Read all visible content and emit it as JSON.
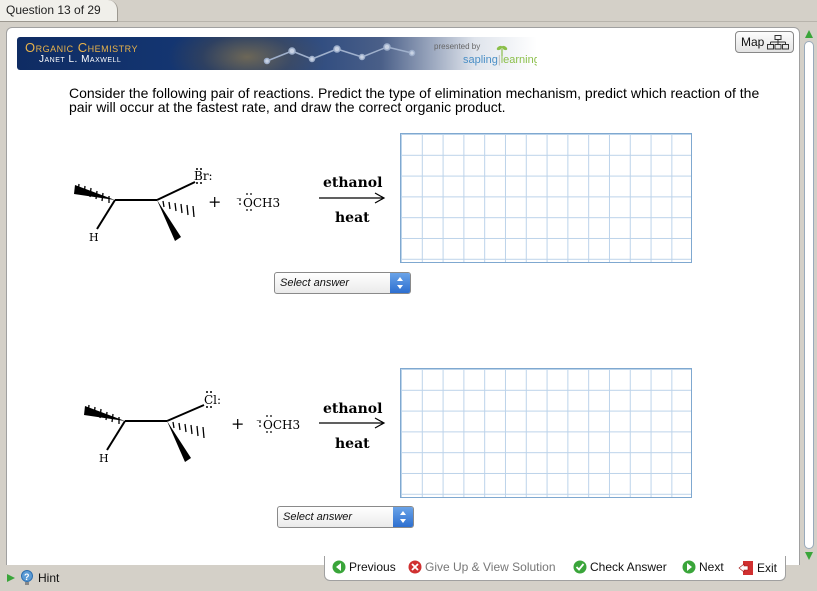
{
  "tab": {
    "label": "Question 13 of 29"
  },
  "banner": {
    "title": "Organic Chemistry",
    "author": "Janet L. Maxwell",
    "presented_by": "presented by",
    "brand_part1": "sapling",
    "brand_part2": "learning"
  },
  "map_button": {
    "label": "Map"
  },
  "question": {
    "text": "Consider the following pair of reactions. Predict the type of elimination mechanism, predict which reaction of the pair will occur at the fastest rate, and draw the correct organic product."
  },
  "reaction1": {
    "leaving_group": "Br:",
    "plus": "+",
    "reagent": "OCH3",
    "solvent": "ethanol",
    "condition": "heat",
    "h_label": "H",
    "select_value": "Select answer"
  },
  "reaction2": {
    "leaving_group": "Cl:",
    "plus": "+",
    "reagent": "OCH3",
    "solvent": "ethanol",
    "condition": "heat",
    "h_label": "H",
    "select_value": "Select answer"
  },
  "footer": {
    "previous": "Previous",
    "give_up": "Give Up & View Solution",
    "check": "Check Answer",
    "next": "Next",
    "exit": "Exit",
    "hint": "Hint"
  },
  "colors": {
    "banner_dark": "#0f2c63",
    "title_gold": "#e8b24a",
    "grid_line": "#bcd3ea",
    "green": "#3aa53a",
    "red": "#d03030"
  }
}
